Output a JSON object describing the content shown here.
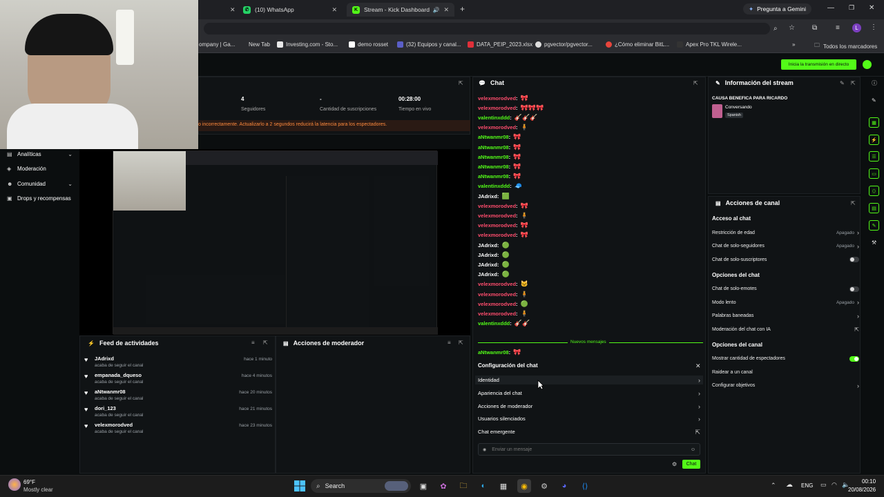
{
  "browser": {
    "tabs": [
      {
        "label": "(10) WhatsApp",
        "icon": "whatsapp-icon",
        "color": "#25d366"
      },
      {
        "label": "Stream - Kick Dashboard",
        "icon": "kick-icon",
        "color": "#53fc18"
      }
    ],
    "gemini_label": "Pregunta a Gemini",
    "bookmarks": [
      {
        "label": "ompany | Ga..."
      },
      {
        "label": "New Tab"
      },
      {
        "label": "Investing.com - Sto..."
      },
      {
        "label": "demo rosset"
      },
      {
        "label": "(32) Equipos y canal..."
      },
      {
        "label": "DATA_PEIP_2023.xlsx"
      },
      {
        "label": "pgvector/pgvector..."
      },
      {
        "label": "¿Cómo eliminar BitL..."
      },
      {
        "label": "Apex Pro TKL Wirele..."
      }
    ],
    "all_bookmarks_label": "Todos los marcadores"
  },
  "header": {
    "go_live_label": "Inicia la transmisión en directo"
  },
  "stats": [
    {
      "value": "4",
      "label": "Seguidores"
    },
    {
      "value": "-",
      "label": "Cantidad de suscripciones"
    },
    {
      "value": "00:28:00",
      "label": "Tiempo en vivo"
    }
  ],
  "warning_text": "o incorrectamente. Actualizarlo a 2 segundos reducirá la latencia para los espectadores.",
  "nav": [
    {
      "label": "Analíticas",
      "icon": "chart-icon",
      "chevron": true
    },
    {
      "label": "Moderación",
      "icon": "shield-icon",
      "chevron": false
    },
    {
      "label": "Comunidad",
      "icon": "people-icon",
      "chevron": true
    },
    {
      "label": "Drops y recompensas",
      "icon": "gift-icon",
      "chevron": false
    }
  ],
  "chat": {
    "title": "Chat",
    "messages": [
      {
        "user": "velexmorodved",
        "color": "#ff4d6d",
        "emote": "🎀"
      },
      {
        "user": "velexmorodved",
        "color": "#ff4d6d",
        "emote": "🎀🎀🎀"
      },
      {
        "user": "valentinxddd",
        "color": "#53fc18",
        "emote": "🎸🎸🎸"
      },
      {
        "user": "velexmorodved",
        "color": "#ff4d6d",
        "emote": "🧍"
      },
      {
        "user": "aNtwanmr08",
        "color": "#53fc18",
        "emote": "🎀"
      },
      {
        "user": "aNtwanmr08",
        "color": "#53fc18",
        "emote": "🎀"
      },
      {
        "user": "aNtwanmr08",
        "color": "#53fc18",
        "emote": "🎀"
      },
      {
        "user": "aNtwanmr08",
        "color": "#53fc18",
        "emote": "🎀"
      },
      {
        "user": "aNtwanmr08",
        "color": "#53fc18",
        "emote": "🎀"
      },
      {
        "user": "valentinxddd",
        "color": "#53fc18",
        "emote": "🧢"
      },
      {
        "user": "JAdrixd",
        "color": "#ffffff",
        "emote": "🟩"
      },
      {
        "user": "velexmorodved",
        "color": "#ff4d6d",
        "emote": "🎀"
      },
      {
        "user": "velexmorodved",
        "color": "#ff4d6d",
        "emote": "🧍"
      },
      {
        "user": "velexmorodved",
        "color": "#ff4d6d",
        "emote": "🎀"
      },
      {
        "user": "velexmorodved",
        "color": "#ff4d6d",
        "emote": "🎀"
      },
      {
        "user": "JAdrixd",
        "color": "#ffffff",
        "emote": "🟢"
      },
      {
        "user": "JAdrixd",
        "color": "#ffffff",
        "emote": "🟢"
      },
      {
        "user": "JAdrixd",
        "color": "#ffffff",
        "emote": "🟢"
      },
      {
        "user": "JAdrixd",
        "color": "#ffffff",
        "emote": "🟢"
      },
      {
        "user": "velexmorodved",
        "color": "#ff4d6d",
        "emote": "🐱"
      },
      {
        "user": "velexmorodved",
        "color": "#ff4d6d",
        "emote": "🧍"
      },
      {
        "user": "velexmorodved",
        "color": "#ff4d6d",
        "emote": "🟢"
      },
      {
        "user": "velexmorodved",
        "color": "#ff4d6d",
        "emote": "🧍"
      },
      {
        "user": "valentinxddd",
        "color": "#53fc18",
        "emote": "🎸🎸"
      }
    ],
    "new_messages_label": "Nuevos mensajes",
    "last_message": {
      "user": "aNtwanmr08",
      "color": "#53fc18",
      "emote": "🎀"
    },
    "config_title": "Configuración del chat",
    "config_items": [
      {
        "label": "Identidad",
        "icon": "chevron-right-icon",
        "glyph": "›"
      },
      {
        "label": "Apariencia del chat",
        "icon": "chevron-right-icon",
        "glyph": "›"
      },
      {
        "label": "Acciones de moderador",
        "icon": "chevron-right-icon",
        "glyph": "›"
      },
      {
        "label": "Usuarios silenciados",
        "icon": "chevron-right-icon",
        "glyph": "›"
      },
      {
        "label": "Chat emergente",
        "icon": "external-link-icon",
        "glyph": "⇱"
      }
    ],
    "input_placeholder": "Enviar un mensaje",
    "send_label": "Chat"
  },
  "feed": {
    "title": "Feed de actividades",
    "items": [
      {
        "name": "JAdrixd",
        "sub": "acaba de seguir el canal",
        "time": "hace 1 minuto"
      },
      {
        "name": "empanada_dqueso",
        "sub": "acaba de seguir el canal",
        "time": "hace 4 minutos"
      },
      {
        "name": "aNtwanmr08",
        "sub": "acaba de seguir el canal",
        "time": "hace 20 minutos"
      },
      {
        "name": "dori_123",
        "sub": "acaba de seguir el canal",
        "time": "hace 21 minutos"
      },
      {
        "name": "velexmorodved",
        "sub": "acaba de seguir el canal",
        "time": "hace 23 minutos"
      }
    ]
  },
  "mod_actions": {
    "title": "Acciones de moderador"
  },
  "stream_info": {
    "title": "Información del stream",
    "stream_title": "CAUSA BENEFICA PARA RICARDO",
    "category": "Conversando",
    "language": "Spanish"
  },
  "channel_actions": {
    "title": "Acciones de canal",
    "sections": [
      {
        "heading": "Acceso al chat",
        "rows": [
          {
            "label": "Restricción de edad",
            "value": "Apagado",
            "control": "chevron"
          },
          {
            "label": "Chat de solo-seguidores",
            "value": "Apagado",
            "control": "chevron"
          },
          {
            "label": "Chat de solo-suscriptores",
            "value": "",
            "control": "toggle-off"
          }
        ]
      },
      {
        "heading": "Opciones del chat",
        "rows": [
          {
            "label": "Chat de solo-emotes",
            "value": "",
            "control": "toggle-off"
          },
          {
            "label": "Modo lento",
            "value": "Apagado",
            "control": "chevron"
          },
          {
            "label": "Palabras baneadas",
            "value": "",
            "control": "chevron"
          },
          {
            "label": "Moderación del chat con IA",
            "value": "",
            "control": "external"
          }
        ]
      },
      {
        "heading": "Opciones del canal",
        "rows": [
          {
            "label": "Mostrar cantidad de espectadores",
            "value": "",
            "control": "toggle-on"
          },
          {
            "label": "Raidear a un canal",
            "value": "",
            "control": "none"
          },
          {
            "label": "Configurar objetivos",
            "value": "",
            "control": "chevron"
          }
        ]
      }
    ]
  },
  "taskbar": {
    "weather_temp": "69°F",
    "weather_desc": "Mostly clear",
    "search_label": "Search",
    "lang": "ENG",
    "time": "00:10",
    "date": "20/08/2026"
  }
}
